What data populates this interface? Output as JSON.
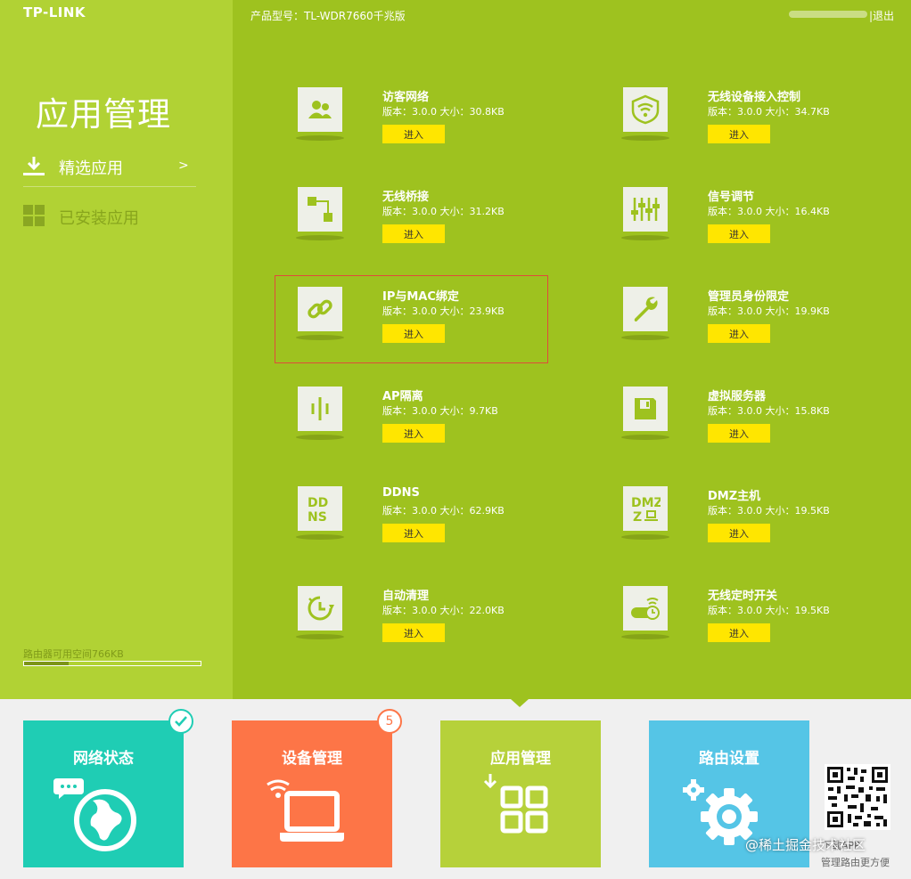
{
  "header": {
    "logo": "TP-LINK",
    "model": "产品型号：TL-WDR7660千兆版",
    "logout": "|退出"
  },
  "sidebar": {
    "title": "应用管理",
    "items": [
      {
        "label": "精选应用",
        "arrow": ">",
        "icon": "download-icon"
      },
      {
        "label": "已安装应用",
        "icon": "grid-icon"
      }
    ],
    "storage_label": "路由器可用空间766KB",
    "storage_fraction": 0.25
  },
  "apps": [
    {
      "name": "访客网络",
      "meta": "版本：3.0.0 大小：30.8KB",
      "button": "进入",
      "icon": "guest-users-icon"
    },
    {
      "name": "无线设备接入控制",
      "meta": "版本：3.0.0 大小：34.7KB",
      "button": "进入",
      "icon": "wifi-shield-icon"
    },
    {
      "name": "无线桥接",
      "meta": "版本：3.0.0 大小：31.2KB",
      "button": "进入",
      "icon": "bridge-icon"
    },
    {
      "name": "信号调节",
      "meta": "版本：3.0.0 大小：16.4KB",
      "button": "进入",
      "icon": "sliders-icon"
    },
    {
      "name": "IP与MAC绑定",
      "meta": "版本：3.0.0 大小：23.9KB",
      "button": "进入",
      "icon": "link-icon"
    },
    {
      "name": "管理员身份限定",
      "meta": "版本：3.0.0 大小：19.9KB",
      "button": "进入",
      "icon": "wrench-icon"
    },
    {
      "name": "AP隔离",
      "meta": "版本：3.0.0 大小：9.7KB",
      "button": "进入",
      "icon": "isolation-icon"
    },
    {
      "name": "虚拟服务器",
      "meta": "版本：3.0.0 大小：15.8KB",
      "button": "进入",
      "icon": "floppy-icon"
    },
    {
      "name": "DDNS",
      "meta": "版本：3.0.0 大小：62.9KB",
      "button": "进入",
      "icon": "ddns-icon"
    },
    {
      "name": "DMZ主机",
      "meta": "版本：3.0.0 大小：19.5KB",
      "button": "进入",
      "icon": "dmz-icon"
    },
    {
      "name": "自动清理",
      "meta": "版本：3.0.0 大小：22.0KB",
      "button": "进入",
      "icon": "clock-refresh-icon"
    },
    {
      "name": "无线定时开关",
      "meta": "版本：3.0.0 大小：19.5KB",
      "button": "进入",
      "icon": "wifi-timer-toggle-icon"
    }
  ],
  "tiles": [
    {
      "title": "网络状态",
      "icon": "globe-chat-icon",
      "badge": "check"
    },
    {
      "title": "设备管理",
      "icon": "laptop-wifi-icon",
      "badge": "5"
    },
    {
      "title": "应用管理",
      "icon": "apps-grid-icon"
    },
    {
      "title": "路由设置",
      "icon": "gear-icon"
    }
  ],
  "footer": {
    "qr_text_1": "下载APP",
    "qr_text_2": "管理路由更方便",
    "watermark": "@稀土掘金技术社区"
  },
  "colors": {
    "main_bg": "#9ec21f",
    "sidebar_bg": "#b1d234",
    "button": "#ffe600",
    "tile_status": "#1fcdb4",
    "tile_devices": "#fd7547",
    "tile_apps": "#b6d13a",
    "tile_router": "#55c5e6",
    "highlight": "#e04b3a"
  }
}
